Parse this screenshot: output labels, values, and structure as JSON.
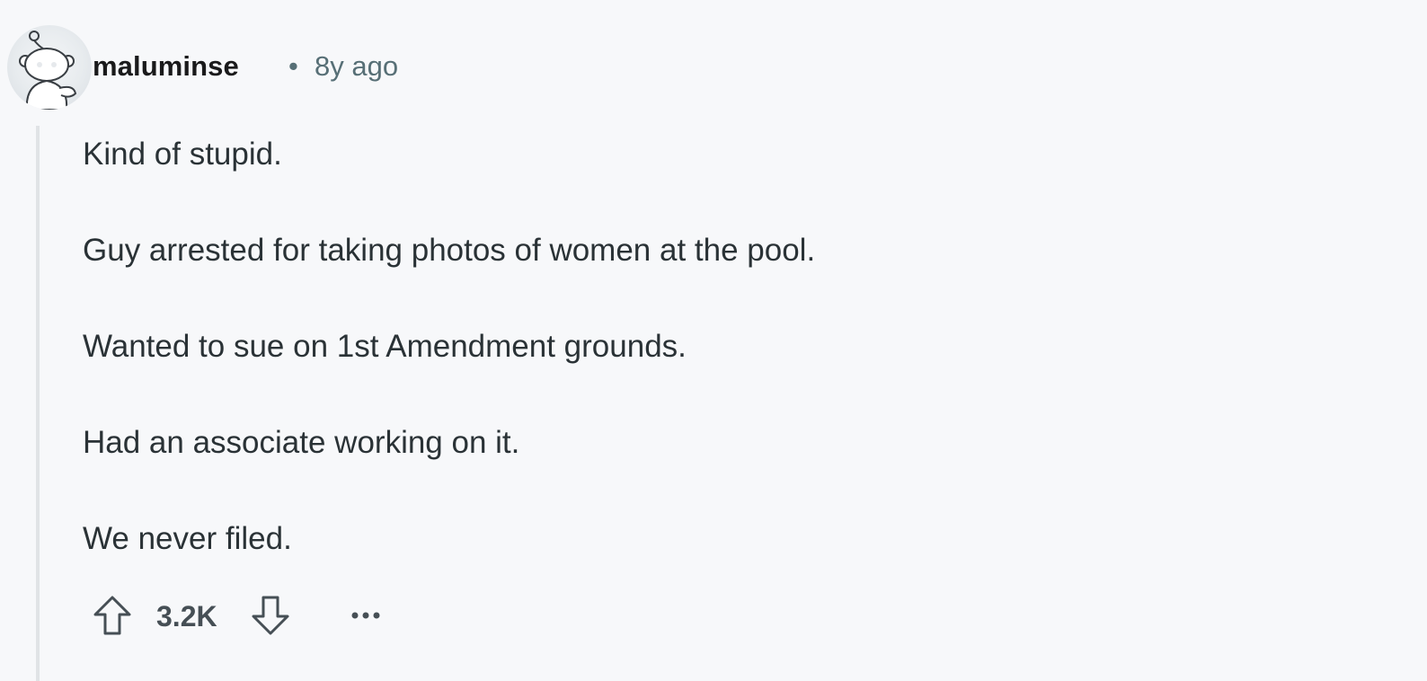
{
  "comment": {
    "author": "maluminse",
    "separator": "•",
    "age": "8y ago",
    "paragraphs": [
      "Kind of stupid.",
      "Guy arrested for taking photos of women at the pool.",
      "Wanted to sue on 1st Amendment grounds.",
      "Had an associate working on it.",
      "We never filed."
    ],
    "score": "3.2K"
  },
  "icons": {
    "avatar": "snoo-avatar",
    "upvote": "upvote-arrow-icon",
    "downvote": "downvote-arrow-icon",
    "more": "more-options-icon"
  },
  "colors": {
    "background": "#f7f8fa",
    "text": "#2a3236",
    "meta": "#576f76",
    "thread_line": "#e0e3e6"
  }
}
